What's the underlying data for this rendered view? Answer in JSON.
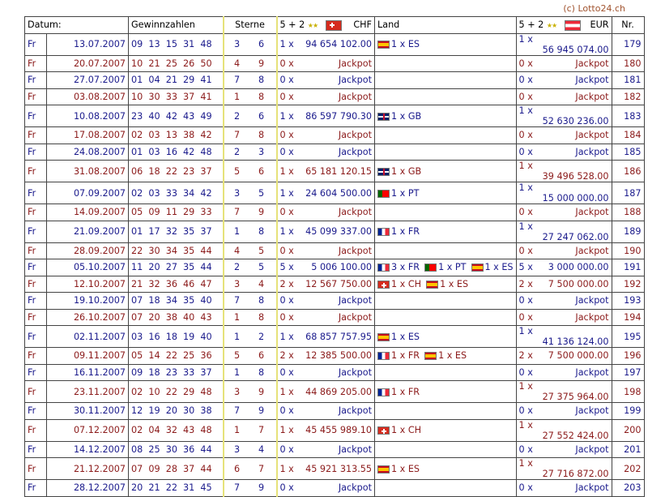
{
  "copyright": "(c) Lotto24.ch",
  "headers": {
    "datum": "Datum:",
    "gewinnzahlen": "Gewinnzahlen",
    "sterne": "Sterne",
    "ch_prefix": "5 + 2",
    "ch_currency": "CHF",
    "land": "Land",
    "at_prefix": "5 + 2",
    "at_currency": "EUR",
    "nr": "Nr.",
    "stars_glyph": "★★"
  },
  "rows": [
    {
      "day": "Fr",
      "date": "13.07.2007",
      "nums": "09  13  15  31  48",
      "s1": "3",
      "s2": "6",
      "ch_cnt": "1 x",
      "ch_amt": "94 654 102.00",
      "land": [
        {
          "flag": "es",
          "text": "1 x ES"
        }
      ],
      "eu_cnt": "1 x",
      "eu_amt": "56 945 074.00",
      "nr": "179"
    },
    {
      "day": "Fr",
      "date": "20.07.2007",
      "nums": "10  21  25  26  50",
      "s1": "4",
      "s2": "9",
      "ch_cnt": "0 x",
      "ch_amt": "Jackpot",
      "land": [],
      "eu_cnt": "0 x",
      "eu_amt": "Jackpot",
      "nr": "180"
    },
    {
      "day": "Fr",
      "date": "27.07.2007",
      "nums": "01  04  21  29  41",
      "s1": "7",
      "s2": "8",
      "ch_cnt": "0 x",
      "ch_amt": "Jackpot",
      "land": [],
      "eu_cnt": "0 x",
      "eu_amt": "Jackpot",
      "nr": "181"
    },
    {
      "day": "Fr",
      "date": "03.08.2007",
      "nums": "10  30  33  37  41",
      "s1": "1",
      "s2": "8",
      "ch_cnt": "0 x",
      "ch_amt": "Jackpot",
      "land": [],
      "eu_cnt": "0 x",
      "eu_amt": "Jackpot",
      "nr": "182"
    },
    {
      "day": "Fr",
      "date": "10.08.2007",
      "nums": "23  40  42  43  49",
      "s1": "2",
      "s2": "6",
      "ch_cnt": "1 x",
      "ch_amt": "86 597 790.30",
      "land": [
        {
          "flag": "gb",
          "text": "1 x GB"
        }
      ],
      "eu_cnt": "1 x",
      "eu_amt": "52 630 236.00",
      "nr": "183"
    },
    {
      "day": "Fr",
      "date": "17.08.2007",
      "nums": "02  03  13  38  42",
      "s1": "7",
      "s2": "8",
      "ch_cnt": "0 x",
      "ch_amt": "Jackpot",
      "land": [],
      "eu_cnt": "0 x",
      "eu_amt": "Jackpot",
      "nr": "184"
    },
    {
      "day": "Fr",
      "date": "24.08.2007",
      "nums": "01  03  16  42  48",
      "s1": "2",
      "s2": "3",
      "ch_cnt": "0 x",
      "ch_amt": "Jackpot",
      "land": [],
      "eu_cnt": "0 x",
      "eu_amt": "Jackpot",
      "nr": "185"
    },
    {
      "day": "Fr",
      "date": "31.08.2007",
      "nums": "06  18  22  23  37",
      "s1": "5",
      "s2": "6",
      "ch_cnt": "1 x",
      "ch_amt": "65 181 120.15",
      "land": [
        {
          "flag": "gb",
          "text": "1 x GB"
        }
      ],
      "eu_cnt": "1 x",
      "eu_amt": "39 496 528.00",
      "nr": "186"
    },
    {
      "day": "Fr",
      "date": "07.09.2007",
      "nums": "02  03  33  34  42",
      "s1": "3",
      "s2": "5",
      "ch_cnt": "1 x",
      "ch_amt": "24 604 500.00",
      "land": [
        {
          "flag": "pt",
          "text": "1 x PT"
        }
      ],
      "eu_cnt": "1 x",
      "eu_amt": "15 000 000.00",
      "nr": "187"
    },
    {
      "day": "Fr",
      "date": "14.09.2007",
      "nums": "05  09  11  29  33",
      "s1": "7",
      "s2": "9",
      "ch_cnt": "0 x",
      "ch_amt": "Jackpot",
      "land": [],
      "eu_cnt": "0 x",
      "eu_amt": "Jackpot",
      "nr": "188"
    },
    {
      "day": "Fr",
      "date": "21.09.2007",
      "nums": "01  17  32  35  37",
      "s1": "1",
      "s2": "8",
      "ch_cnt": "1 x",
      "ch_amt": "45 099 337.00",
      "land": [
        {
          "flag": "fr",
          "text": "1 x FR"
        }
      ],
      "eu_cnt": "1 x",
      "eu_amt": "27 247 062.00",
      "nr": "189"
    },
    {
      "day": "Fr",
      "date": "28.09.2007",
      "nums": "22  30  34  35  44",
      "s1": "4",
      "s2": "5",
      "ch_cnt": "0 x",
      "ch_amt": "Jackpot",
      "land": [],
      "eu_cnt": "0 x",
      "eu_amt": "Jackpot",
      "nr": "190"
    },
    {
      "day": "Fr",
      "date": "05.10.2007",
      "nums": "11  20  27  35  44",
      "s1": "2",
      "s2": "5",
      "ch_cnt": "5 x",
      "ch_amt": "5 006 100.00",
      "land": [
        {
          "flag": "fr",
          "text": "3 x FR"
        },
        {
          "flag": "pt",
          "text": "1 x PT"
        },
        {
          "flag": "es",
          "text": "1 x ES"
        }
      ],
      "eu_cnt": "5 x",
      "eu_amt": "3 000 000.00",
      "nr": "191"
    },
    {
      "day": "Fr",
      "date": "12.10.2007",
      "nums": "21  32  36  46  47",
      "s1": "3",
      "s2": "4",
      "ch_cnt": "2 x",
      "ch_amt": "12 567 750.00",
      "land": [
        {
          "flag": "ch",
          "text": "1 x CH"
        },
        {
          "flag": "es",
          "text": "1 x ES"
        }
      ],
      "eu_cnt": "2 x",
      "eu_amt": "7 500 000.00",
      "nr": "192"
    },
    {
      "day": "Fr",
      "date": "19.10.2007",
      "nums": "07  18  34  35  40",
      "s1": "7",
      "s2": "8",
      "ch_cnt": "0 x",
      "ch_amt": "Jackpot",
      "land": [],
      "eu_cnt": "0 x",
      "eu_amt": "Jackpot",
      "nr": "193"
    },
    {
      "day": "Fr",
      "date": "26.10.2007",
      "nums": "07  20  38  40  43",
      "s1": "1",
      "s2": "8",
      "ch_cnt": "0 x",
      "ch_amt": "Jackpot",
      "land": [],
      "eu_cnt": "0 x",
      "eu_amt": "Jackpot",
      "nr": "194"
    },
    {
      "day": "Fr",
      "date": "02.11.2007",
      "nums": "03  16  18  19  40",
      "s1": "1",
      "s2": "2",
      "ch_cnt": "1 x",
      "ch_amt": "68 857 757.95",
      "land": [
        {
          "flag": "es",
          "text": "1 x ES"
        }
      ],
      "eu_cnt": "1 x",
      "eu_amt": "41 136 124.00",
      "nr": "195"
    },
    {
      "day": "Fr",
      "date": "09.11.2007",
      "nums": "05  14  22  25  36",
      "s1": "5",
      "s2": "6",
      "ch_cnt": "2 x",
      "ch_amt": "12 385 500.00",
      "land": [
        {
          "flag": "fr",
          "text": "1 x FR"
        },
        {
          "flag": "es",
          "text": "1 x ES"
        }
      ],
      "eu_cnt": "2 x",
      "eu_amt": "7 500 000.00",
      "nr": "196"
    },
    {
      "day": "Fr",
      "date": "16.11.2007",
      "nums": "09  18  23  33  37",
      "s1": "1",
      "s2": "8",
      "ch_cnt": "0 x",
      "ch_amt": "Jackpot",
      "land": [],
      "eu_cnt": "0 x",
      "eu_amt": "Jackpot",
      "nr": "197"
    },
    {
      "day": "Fr",
      "date": "23.11.2007",
      "nums": "02  10  22  29  48",
      "s1": "3",
      "s2": "9",
      "ch_cnt": "1 x",
      "ch_amt": "44 869 205.00",
      "land": [
        {
          "flag": "fr",
          "text": "1 x FR"
        }
      ],
      "eu_cnt": "1 x",
      "eu_amt": "27 375 964.00",
      "nr": "198"
    },
    {
      "day": "Fr",
      "date": "30.11.2007",
      "nums": "12  19  20  30  38",
      "s1": "7",
      "s2": "9",
      "ch_cnt": "0 x",
      "ch_amt": "Jackpot",
      "land": [],
      "eu_cnt": "0 x",
      "eu_amt": "Jackpot",
      "nr": "199"
    },
    {
      "day": "Fr",
      "date": "07.12.2007",
      "nums": "02  04  32  43  48",
      "s1": "1",
      "s2": "7",
      "ch_cnt": "1 x",
      "ch_amt": "45 455 989.10",
      "land": [
        {
          "flag": "ch",
          "text": "1 x CH"
        }
      ],
      "eu_cnt": "1 x",
      "eu_amt": "27 552 424.00",
      "nr": "200"
    },
    {
      "day": "Fr",
      "date": "14.12.2007",
      "nums": "08  25  30  36  44",
      "s1": "3",
      "s2": "4",
      "ch_cnt": "0 x",
      "ch_amt": "Jackpot",
      "land": [],
      "eu_cnt": "0 x",
      "eu_amt": "Jackpot",
      "nr": "201"
    },
    {
      "day": "Fr",
      "date": "21.12.2007",
      "nums": "07  09  28  37  44",
      "s1": "6",
      "s2": "7",
      "ch_cnt": "1 x",
      "ch_amt": "45 921 313.55",
      "land": [
        {
          "flag": "es",
          "text": "1 x ES"
        }
      ],
      "eu_cnt": "1 x",
      "eu_amt": "27 716 872.00",
      "nr": "202"
    },
    {
      "day": "Fr",
      "date": "28.12.2007",
      "nums": "20  21  22  31  45",
      "s1": "7",
      "s2": "9",
      "ch_cnt": "0 x",
      "ch_amt": "Jackpot",
      "land": [],
      "eu_cnt": "0 x",
      "eu_amt": "Jackpot",
      "nr": "203"
    }
  ]
}
